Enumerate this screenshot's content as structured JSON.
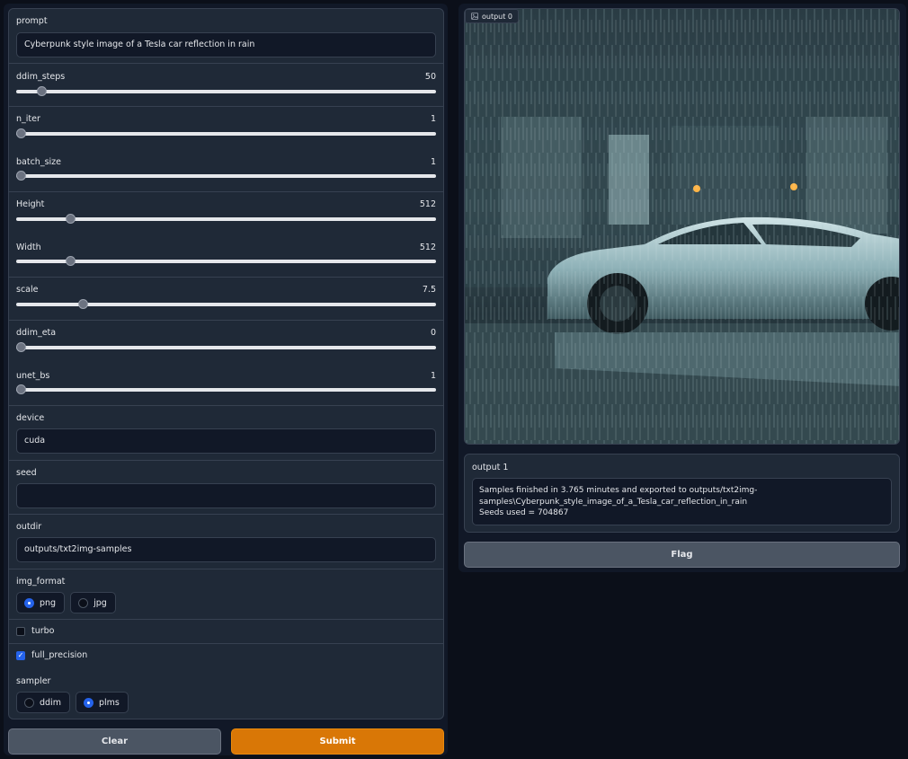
{
  "inputs": {
    "prompt": {
      "label": "prompt",
      "value": "Cyberpunk style image of a Tesla car reflection in rain"
    },
    "ddim_steps": {
      "label": "ddim_steps",
      "value": "50",
      "fraction": 0.05
    },
    "n_iter": {
      "label": "n_iter",
      "value": "1",
      "fraction": 0.0
    },
    "batch_size": {
      "label": "batch_size",
      "value": "1",
      "fraction": 0.0
    },
    "height": {
      "label": "Height",
      "value": "512",
      "fraction": 0.12
    },
    "width": {
      "label": "Width",
      "value": "512",
      "fraction": 0.12
    },
    "scale": {
      "label": "scale",
      "value": "7.5",
      "fraction": 0.15
    },
    "ddim_eta": {
      "label": "ddim_eta",
      "value": "0",
      "fraction": 0.0
    },
    "unet_bs": {
      "label": "unet_bs",
      "value": "1",
      "fraction": 0.0
    },
    "device": {
      "label": "device",
      "value": "cuda"
    },
    "seed": {
      "label": "seed",
      "value": ""
    },
    "outdir": {
      "label": "outdir",
      "value": "outputs/txt2img-samples"
    },
    "img_format": {
      "label": "img_format",
      "options": [
        "png",
        "jpg"
      ],
      "selected": "png"
    },
    "turbo": {
      "label": "turbo",
      "checked": false
    },
    "full_precision": {
      "label": "full_precision",
      "checked": true
    },
    "sampler": {
      "label": "sampler",
      "options": [
        "ddim",
        "plms"
      ],
      "selected": "plms"
    }
  },
  "buttons": {
    "clear": "Clear",
    "submit": "Submit",
    "flag": "Flag"
  },
  "output0": {
    "label": "output 0"
  },
  "output1": {
    "label": "output 1",
    "line1": "Samples finished in 3.765 minutes and exported to outputs/txt2img-",
    "line2": "samples\\Cyberpunk_style_image_of_a_Tesla_car_reflection_in_rain",
    "line3": "Seeds used = 704867"
  },
  "colors": {
    "accent": "#d97706",
    "selected": "#2563eb",
    "background": "#0b0f19",
    "panel": "#1f2937"
  }
}
